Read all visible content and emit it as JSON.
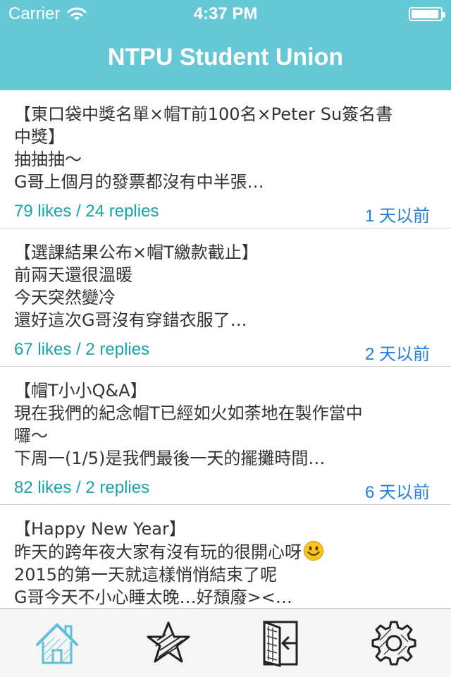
{
  "status": {
    "carrier": "Carrier",
    "time": "4:37 PM",
    "battery_level": 0.95
  },
  "nav": {
    "title": "NTPU Student Union"
  },
  "posts": [
    {
      "lines": [
        "【東口袋中獎名單×帽T前100名×Peter Su簽名書",
        "中獎】",
        "抽抽抽～",
        "G哥上個月的發票都沒有中半張…"
      ],
      "stats": "79 likes / 24 replies",
      "date": "1 天以前"
    },
    {
      "lines": [
        "【選課結果公布×帽T繳款截止】",
        "前兩天還很溫暖",
        "今天突然變冷",
        "還好這次G哥沒有穿錯衣服了…"
      ],
      "stats": "67 likes / 2 replies",
      "date": "2 天以前"
    },
    {
      "lines": [
        "【帽T小小Q&A】",
        "現在我們的紀念帽T已經如火如荼地在製作當中",
        "囉～",
        "下周一(1/5)是我們最後一天的擺攤時間…"
      ],
      "stats": "82 likes / 2 replies",
      "date": "6 天以前"
    },
    {
      "lines": [
        "【Happy New Year】",
        "昨天的跨年夜大家有沒有玩的很開心呀",
        "2015的第一天就這樣悄悄結束了呢",
        "G哥今天不小心睡太晚…好頹廢><…"
      ],
      "stats": "",
      "date": ""
    }
  ],
  "tabs": [
    {
      "icon": "home-icon",
      "active": true
    },
    {
      "icon": "star-icon",
      "active": false
    },
    {
      "icon": "logout-door-icon",
      "active": false
    },
    {
      "icon": "gear-icon",
      "active": false
    }
  ],
  "colors": {
    "header": "#66c8d6",
    "likes": "#1aa3a8",
    "date": "#1f7fe0",
    "active_tab": "#5cc0d8"
  }
}
